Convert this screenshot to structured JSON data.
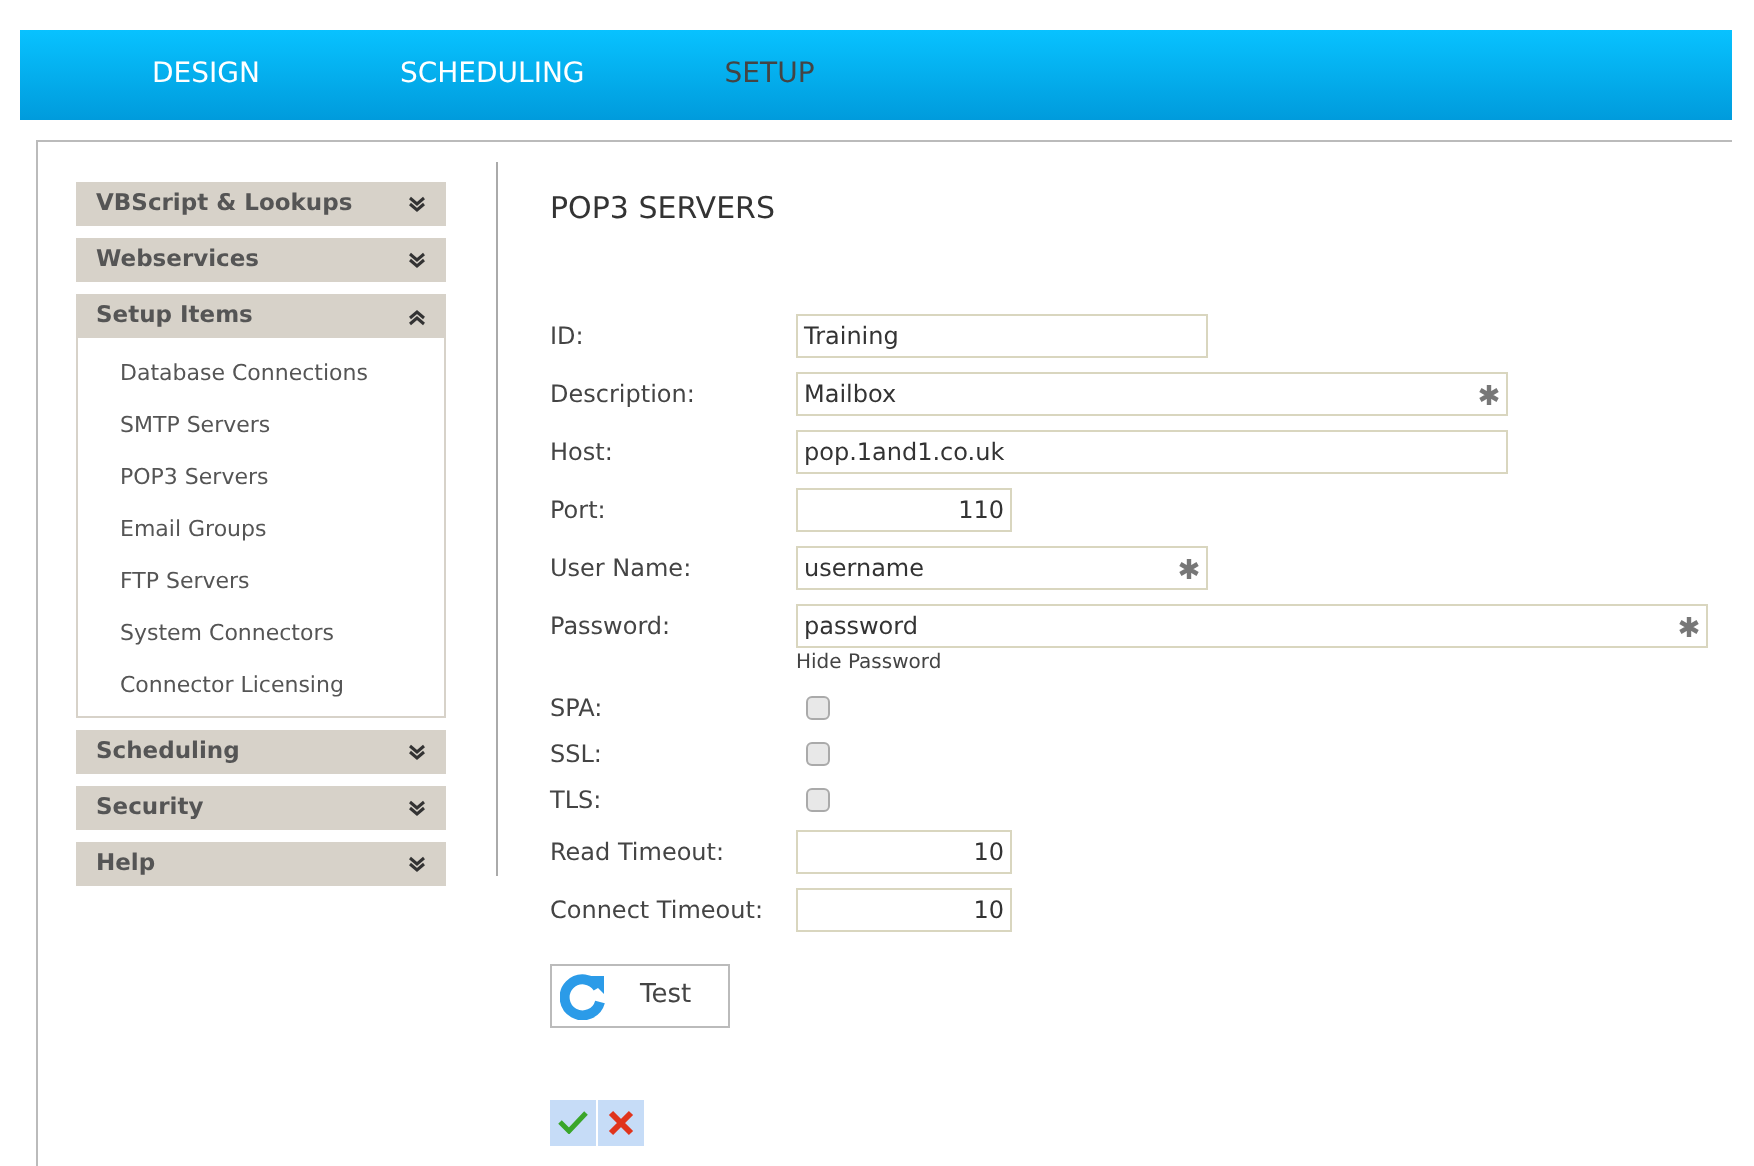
{
  "nav": [
    {
      "label": "DESIGN",
      "selected": false
    },
    {
      "label": "SCHEDULING",
      "selected": false
    },
    {
      "label": "SETUP",
      "selected": true
    }
  ],
  "sidebar": [
    {
      "label": "VBScript & Lookups",
      "expanded": false
    },
    {
      "label": "Webservices",
      "expanded": false
    },
    {
      "label": "Setup Items",
      "expanded": true,
      "children": [
        "Database Connections",
        "SMTP Servers",
        "POP3 Servers",
        "Email Groups",
        "FTP Servers",
        "System Connectors",
        "Connector Licensing"
      ]
    },
    {
      "label": "Scheduling",
      "expanded": false
    },
    {
      "label": "Security",
      "expanded": false
    },
    {
      "label": "Help",
      "expanded": false
    }
  ],
  "title": "POP3 SERVERS",
  "fields": [
    {
      "kind": "text",
      "label": "ID:",
      "value": "Training",
      "required": false
    },
    {
      "kind": "text",
      "label": "Description:",
      "value": "Mailbox",
      "required": true
    },
    {
      "kind": "text",
      "label": "Host:",
      "value": "pop.1and1.co.uk",
      "required": false
    },
    {
      "kind": "number",
      "label": "Port:",
      "value": "110"
    },
    {
      "kind": "text",
      "label": "User Name:",
      "value": "username",
      "required": true
    },
    {
      "kind": "password",
      "label": "Password:",
      "value": "password",
      "required": true,
      "note": "Hide Password"
    },
    {
      "kind": "checkbox",
      "label": "SPA:",
      "checked": false
    },
    {
      "kind": "checkbox",
      "label": "SSL:",
      "checked": false
    },
    {
      "kind": "checkbox",
      "label": "TLS:",
      "checked": false
    },
    {
      "kind": "number",
      "label": "Read Timeout:",
      "value": "10"
    },
    {
      "kind": "number",
      "label": "Connect Timeout:",
      "value": "10"
    }
  ],
  "test_button": "Test"
}
